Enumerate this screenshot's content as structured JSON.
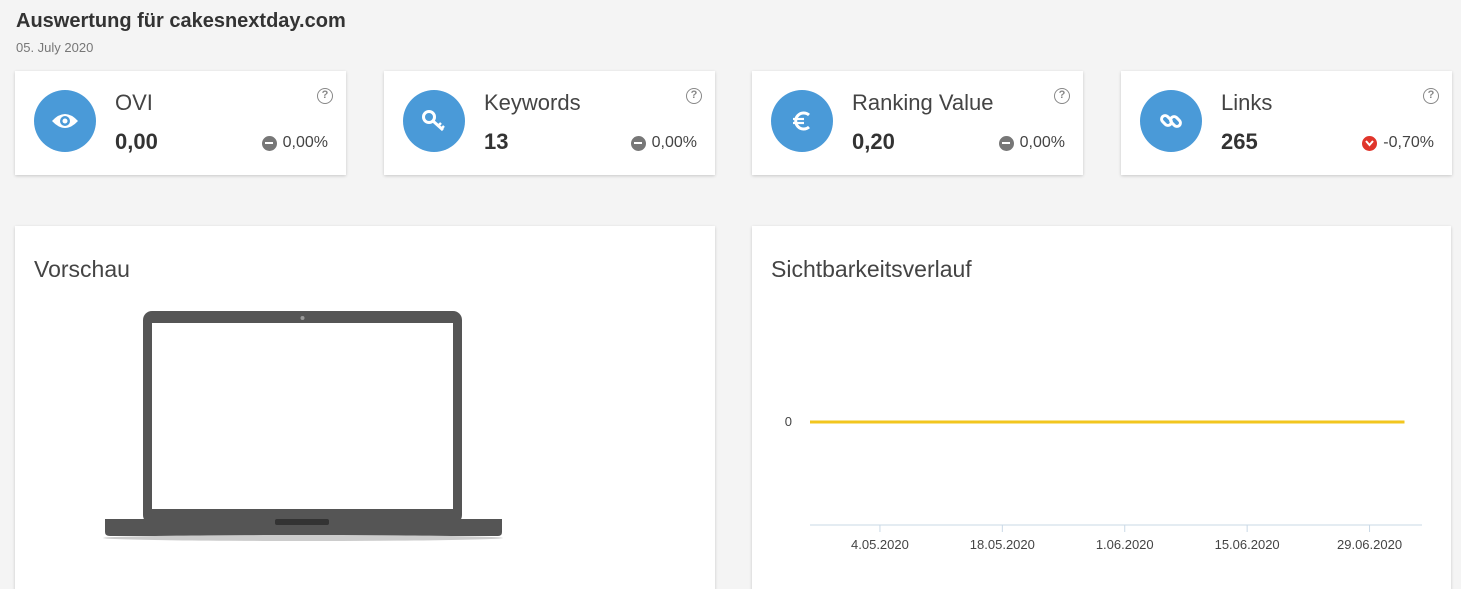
{
  "header": {
    "title": "Auswertung für cakesnextday.com",
    "date": "05. July 2020"
  },
  "kpis": [
    {
      "label": "OVI",
      "value": "0,00",
      "change": "0,00%",
      "trend": "neutral",
      "icon": "eye-icon",
      "help": "?"
    },
    {
      "label": "Keywords",
      "value": "13",
      "change": "0,00%",
      "trend": "neutral",
      "icon": "key-icon",
      "help": "?"
    },
    {
      "label": "Ranking Value",
      "value": "0,20",
      "change": "0,00%",
      "trend": "neutral",
      "icon": "euro-icon",
      "help": "?"
    },
    {
      "label": "Links",
      "value": "265",
      "change": "-0,70%",
      "trend": "down",
      "icon": "link-icon",
      "help": "?"
    }
  ],
  "preview": {
    "title": "Vorschau"
  },
  "history": {
    "title": "Sichtbarkeitsverlauf"
  },
  "colors": {
    "accent": "#4a9ad8",
    "line": "#f2c61f",
    "down": "#e0352b",
    "neutral": "#777777"
  },
  "chart_data": {
    "type": "line",
    "title": "Sichtbarkeitsverlauf",
    "x_ticks": [
      "4.05.2020",
      "18.05.2020",
      "1.06.2020",
      "15.06.2020",
      "29.06.2020"
    ],
    "y_ticks": [
      "0"
    ],
    "x_range": [
      "2020-04-26",
      "2020-07-05"
    ],
    "series": [
      {
        "values": [
          {
            "x": "2020-04-26",
            "y": 0
          },
          {
            "x": "2020-07-03",
            "y": 0
          }
        ]
      }
    ],
    "grid": false,
    "legend": "none"
  }
}
